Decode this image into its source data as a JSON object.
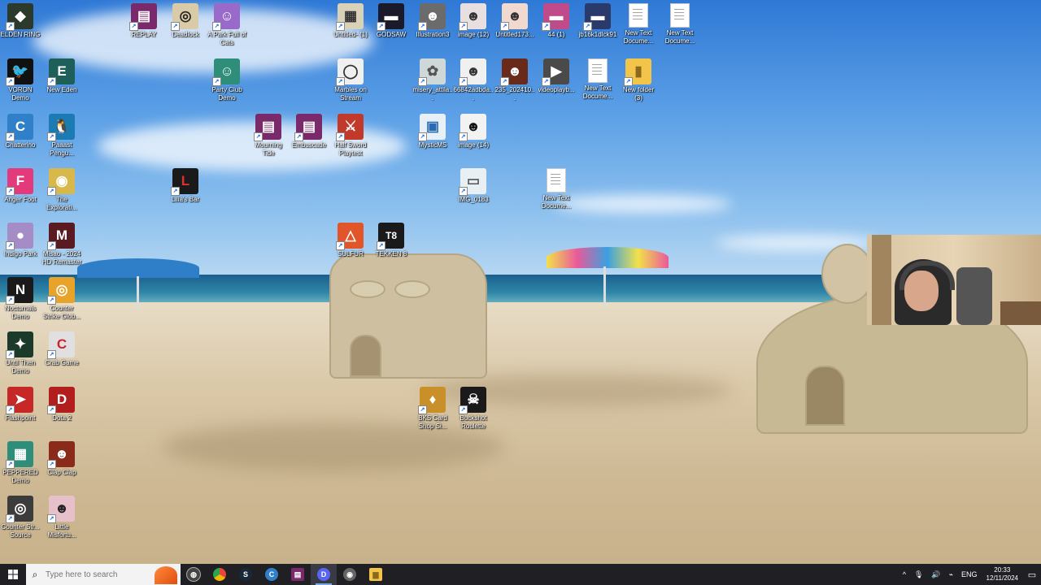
{
  "desktop": {
    "icons": [
      {
        "label": "ELDEN RING",
        "glyph": "◆",
        "color": "#2b3a2a"
      },
      {
        "label": "VORON Demo",
        "glyph": "🐦",
        "color": "#111111"
      },
      {
        "label": "Chatterino",
        "glyph": "C",
        "color": "#2f80c8"
      },
      {
        "label": "Anger Foot",
        "glyph": "F",
        "color": "#e23a7a"
      },
      {
        "label": "Indigo Park",
        "glyph": "●",
        "color": "#a58cc7"
      },
      {
        "label": "Nocturnals Demo",
        "glyph": "N",
        "color": "#1a1a1a"
      },
      {
        "label": "Until Then Demo",
        "glyph": "✦",
        "color": "#1c3a2a"
      },
      {
        "label": "Flashpoint",
        "glyph": "➤",
        "color": "#c62828"
      },
      {
        "label": "PEPPERED Demo",
        "glyph": "▦",
        "color": "#2f8e7a"
      },
      {
        "label": "Counter Str... Source",
        "glyph": "◎",
        "color": "#3c3c3c"
      },
      {
        "label": "New Eden",
        "glyph": "E",
        "color": "#1f5f5a"
      },
      {
        "label": "Paaast Pengu...",
        "glyph": "🐧",
        "color": "#1d7bb3"
      },
      {
        "label": "The Explorati...",
        "glyph": "◉",
        "color": "#d8b84a"
      },
      {
        "label": "Misao - 2024 HD Remaster",
        "glyph": "M",
        "color": "#5a1a22"
      },
      {
        "label": "Counter Strike Glob...",
        "glyph": "◎",
        "color": "#e8a32a"
      },
      {
        "label": "Crab Game",
        "glyph": "C",
        "color": "#e0e0e0"
      },
      {
        "label": "Dota 2",
        "glyph": "D",
        "color": "#b21e1e"
      },
      {
        "label": "Clap Clap",
        "glyph": "☻",
        "color": "#8a2a1a"
      },
      {
        "label": "Little Misfortu...",
        "glyph": "☻",
        "color": "#e6c1c9"
      },
      {
        "label": "REPLAY",
        "glyph": "▤",
        "color": "#7a2a6a"
      },
      {
        "label": "Deadlock",
        "glyph": "◎",
        "color": "#d9cba8"
      },
      {
        "label": "Lilia's Bar",
        "glyph": "L",
        "color": "#1a1a1a"
      },
      {
        "label": "A Park Full of Cats",
        "glyph": "☺",
        "color": "#9a6acb"
      },
      {
        "label": "Party Club Demo",
        "glyph": "☺",
        "color": "#2f8e7a"
      },
      {
        "label": "Mourning Tide",
        "glyph": "▤",
        "color": "#7a2a6a"
      },
      {
        "label": "Embuscade",
        "glyph": "▤",
        "color": "#7a2a6a"
      },
      {
        "label": "Untitled- (1)",
        "glyph": "▦",
        "color": "#d9d2b8"
      },
      {
        "label": "Marbles on Stream",
        "glyph": "◯",
        "color": "#f0f0f0"
      },
      {
        "label": "Half Sword Playtest",
        "glyph": "⚔",
        "color": "#c0392b"
      },
      {
        "label": "SULFUR",
        "glyph": "△",
        "color": "#e0552a"
      },
      {
        "label": "GODSAW",
        "glyph": "▬",
        "color": "#1a1a2a"
      },
      {
        "label": "TEKKEN 8",
        "glyph": "T8",
        "color": "#1a1a1a"
      },
      {
        "label": "Illustration3",
        "glyph": "☻",
        "color": "#6b6b6b"
      },
      {
        "label": "misery_attila...",
        "glyph": "✿",
        "color": "#cfd8d8"
      },
      {
        "label": "MysticMS",
        "glyph": "▣",
        "color": "#e7f0f6"
      },
      {
        "label": "BKS Card Shop Si...",
        "glyph": "♦",
        "color": "#c9902a"
      },
      {
        "label": "image (12)",
        "glyph": "☻",
        "color": "#e8e0e0"
      },
      {
        "label": "66842adbda...",
        "glyph": "☻",
        "color": "#f0f0f0"
      },
      {
        "label": "image (14)",
        "glyph": "☻",
        "color": "#f2f2f2"
      },
      {
        "label": "IMG_0183",
        "glyph": "▭",
        "color": "#e8f0f4"
      },
      {
        "label": "Buckshot Roulette",
        "glyph": "☠",
        "color": "#1a1a1a"
      },
      {
        "label": "Untitled173...",
        "glyph": "☻",
        "color": "#f2d9d0"
      },
      {
        "label": "235_202410...",
        "glyph": "☻",
        "color": "#6a2a1a"
      },
      {
        "label": "44 (1)",
        "glyph": "▬",
        "color": "#c04a8a"
      },
      {
        "label": "videoplayb...",
        "glyph": "▶",
        "color": "#4a4a4a"
      },
      {
        "label": "New Text Docume...",
        "glyph": "",
        "color": "#ffffff",
        "doc": true
      },
      {
        "label": "New Text Docume...",
        "glyph": "",
        "color": "#ffffff",
        "doc": true
      },
      {
        "label": "jb16k1dlck91",
        "glyph": "▬",
        "color": "#2a3a6a"
      },
      {
        "label": "New folder (3)",
        "glyph": "▮",
        "color": "#f3c44a"
      },
      {
        "label": "New Text Docume...",
        "glyph": "",
        "color": "#ffffff",
        "doc": true
      },
      {
        "label": "New Text Docume...",
        "glyph": "",
        "color": "#ffffff",
        "doc": true
      }
    ]
  },
  "taskbar": {
    "start_icon": "windows-logo-icon",
    "search_placeholder": "Type here to search",
    "apps": [
      {
        "name": "task-view",
        "glyph": "◍",
        "color": "#444444"
      },
      {
        "name": "chrome",
        "glyph": "●",
        "color": "#e8453c"
      },
      {
        "name": "steam",
        "glyph": "S",
        "color": "#1b2838"
      },
      {
        "name": "chatterino",
        "glyph": "C",
        "color": "#2f80c8"
      },
      {
        "name": "archive",
        "glyph": "▤",
        "color": "#7a2a6a"
      },
      {
        "name": "discord",
        "glyph": "D",
        "color": "#5865f2"
      },
      {
        "name": "obs",
        "glyph": "◉",
        "color": "#666666"
      },
      {
        "name": "file-explorer",
        "glyph": "▆",
        "color": "#f3c44a"
      }
    ],
    "tray": {
      "language": "ENG",
      "time": "20:33",
      "date": "12/11/2024"
    }
  }
}
